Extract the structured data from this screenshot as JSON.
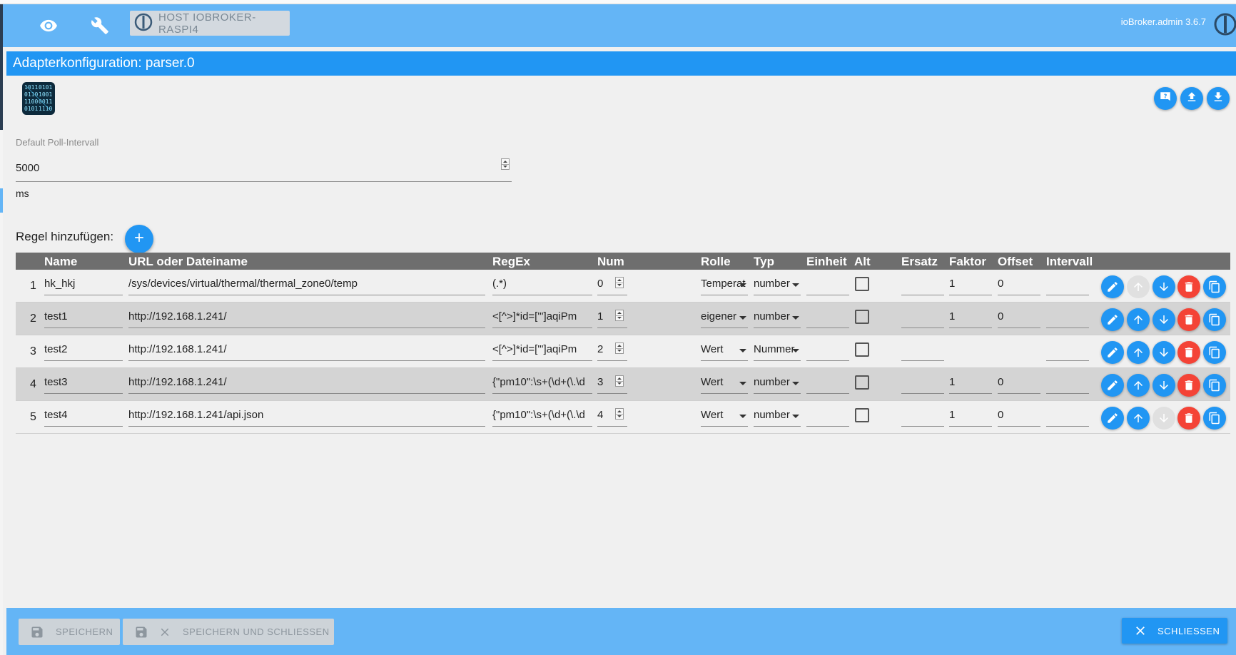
{
  "header": {
    "host_label": "HOST IOBROKER-RASPI4",
    "version": "ioBroker.admin 3.6.7",
    "icons": [
      "eye-icon",
      "wrench-icon",
      "iobroker-logo-icon"
    ]
  },
  "title": "Adapterkonfiguration: parser.0",
  "toolbar_icons": [
    "help-icon",
    "upload-icon",
    "download-icon"
  ],
  "poll": {
    "label": "Default Poll-Intervall",
    "value": "5000",
    "unit": "ms"
  },
  "add_rule_label": "Regel hinzufügen:",
  "table": {
    "columns": [
      "Name",
      "URL oder Dateiname",
      "RegEx",
      "Num",
      "Rolle",
      "Typ",
      "Einheit",
      "Alt",
      "Ersatz",
      "Faktor",
      "Offset",
      "Intervall"
    ],
    "rows": [
      {
        "num": "1",
        "name": "hk_hkj",
        "url": "/sys/devices/virtual/thermal/thermal_zone0/temp",
        "regex": "(.*)",
        "index": "0",
        "role": "Temperat",
        "type": "number",
        "unit": "",
        "alt": false,
        "substitute": "",
        "factor": "1",
        "offset": "0",
        "interval": "",
        "up_enabled": false,
        "down_enabled": true
      },
      {
        "num": "2",
        "name": "test1",
        "url": "http://192.168.1.241/",
        "regex": "<[^>]*id=[\"']aqiPm",
        "index": "1",
        "role": "eigener",
        "type": "number",
        "unit": "",
        "alt": false,
        "substitute": "",
        "factor": "1",
        "offset": "0",
        "interval": "",
        "up_enabled": true,
        "down_enabled": true
      },
      {
        "num": "3",
        "name": "test2",
        "url": "http://192.168.1.241/",
        "regex": "<[^>]*id=[\"']aqiPm",
        "index": "2",
        "role": "Wert",
        "type": "Nummer",
        "unit": "",
        "alt": false,
        "substitute": "",
        "factor": "",
        "offset": "",
        "interval": "",
        "up_enabled": true,
        "down_enabled": true
      },
      {
        "num": "4",
        "name": "test3",
        "url": "http://192.168.1.241/",
        "regex": "{\"pm10\":\\s+(\\d+(\\.\\d",
        "index": "3",
        "role": "Wert",
        "type": "number",
        "unit": "",
        "alt": false,
        "substitute": "",
        "factor": "1",
        "offset": "0",
        "interval": "",
        "up_enabled": true,
        "down_enabled": true
      },
      {
        "num": "5",
        "name": "test4",
        "url": "http://192.168.1.241/api.json",
        "regex": "{\"pm10\":\\s+(\\d+(\\.\\d",
        "index": "4",
        "role": "Wert",
        "type": "number",
        "unit": "",
        "alt": false,
        "substitute": "",
        "factor": "1",
        "offset": "0",
        "interval": "",
        "up_enabled": true,
        "down_enabled": false
      }
    ],
    "row_actions": [
      "edit-icon",
      "arrow-up-icon",
      "arrow-down-icon",
      "delete-icon",
      "copy-icon"
    ]
  },
  "footer": {
    "save_label": "SPEICHERN",
    "save_close_label": "SPEICHERN UND SCHLIESSEN",
    "close_label": "SCHLIESSEN"
  },
  "colors": {
    "header_bg": "#64b5f6",
    "title_bg": "#2196f3",
    "table_header_bg": "#6e6e6e",
    "delete": "#f44336",
    "disabled": "#e0e0e0"
  }
}
